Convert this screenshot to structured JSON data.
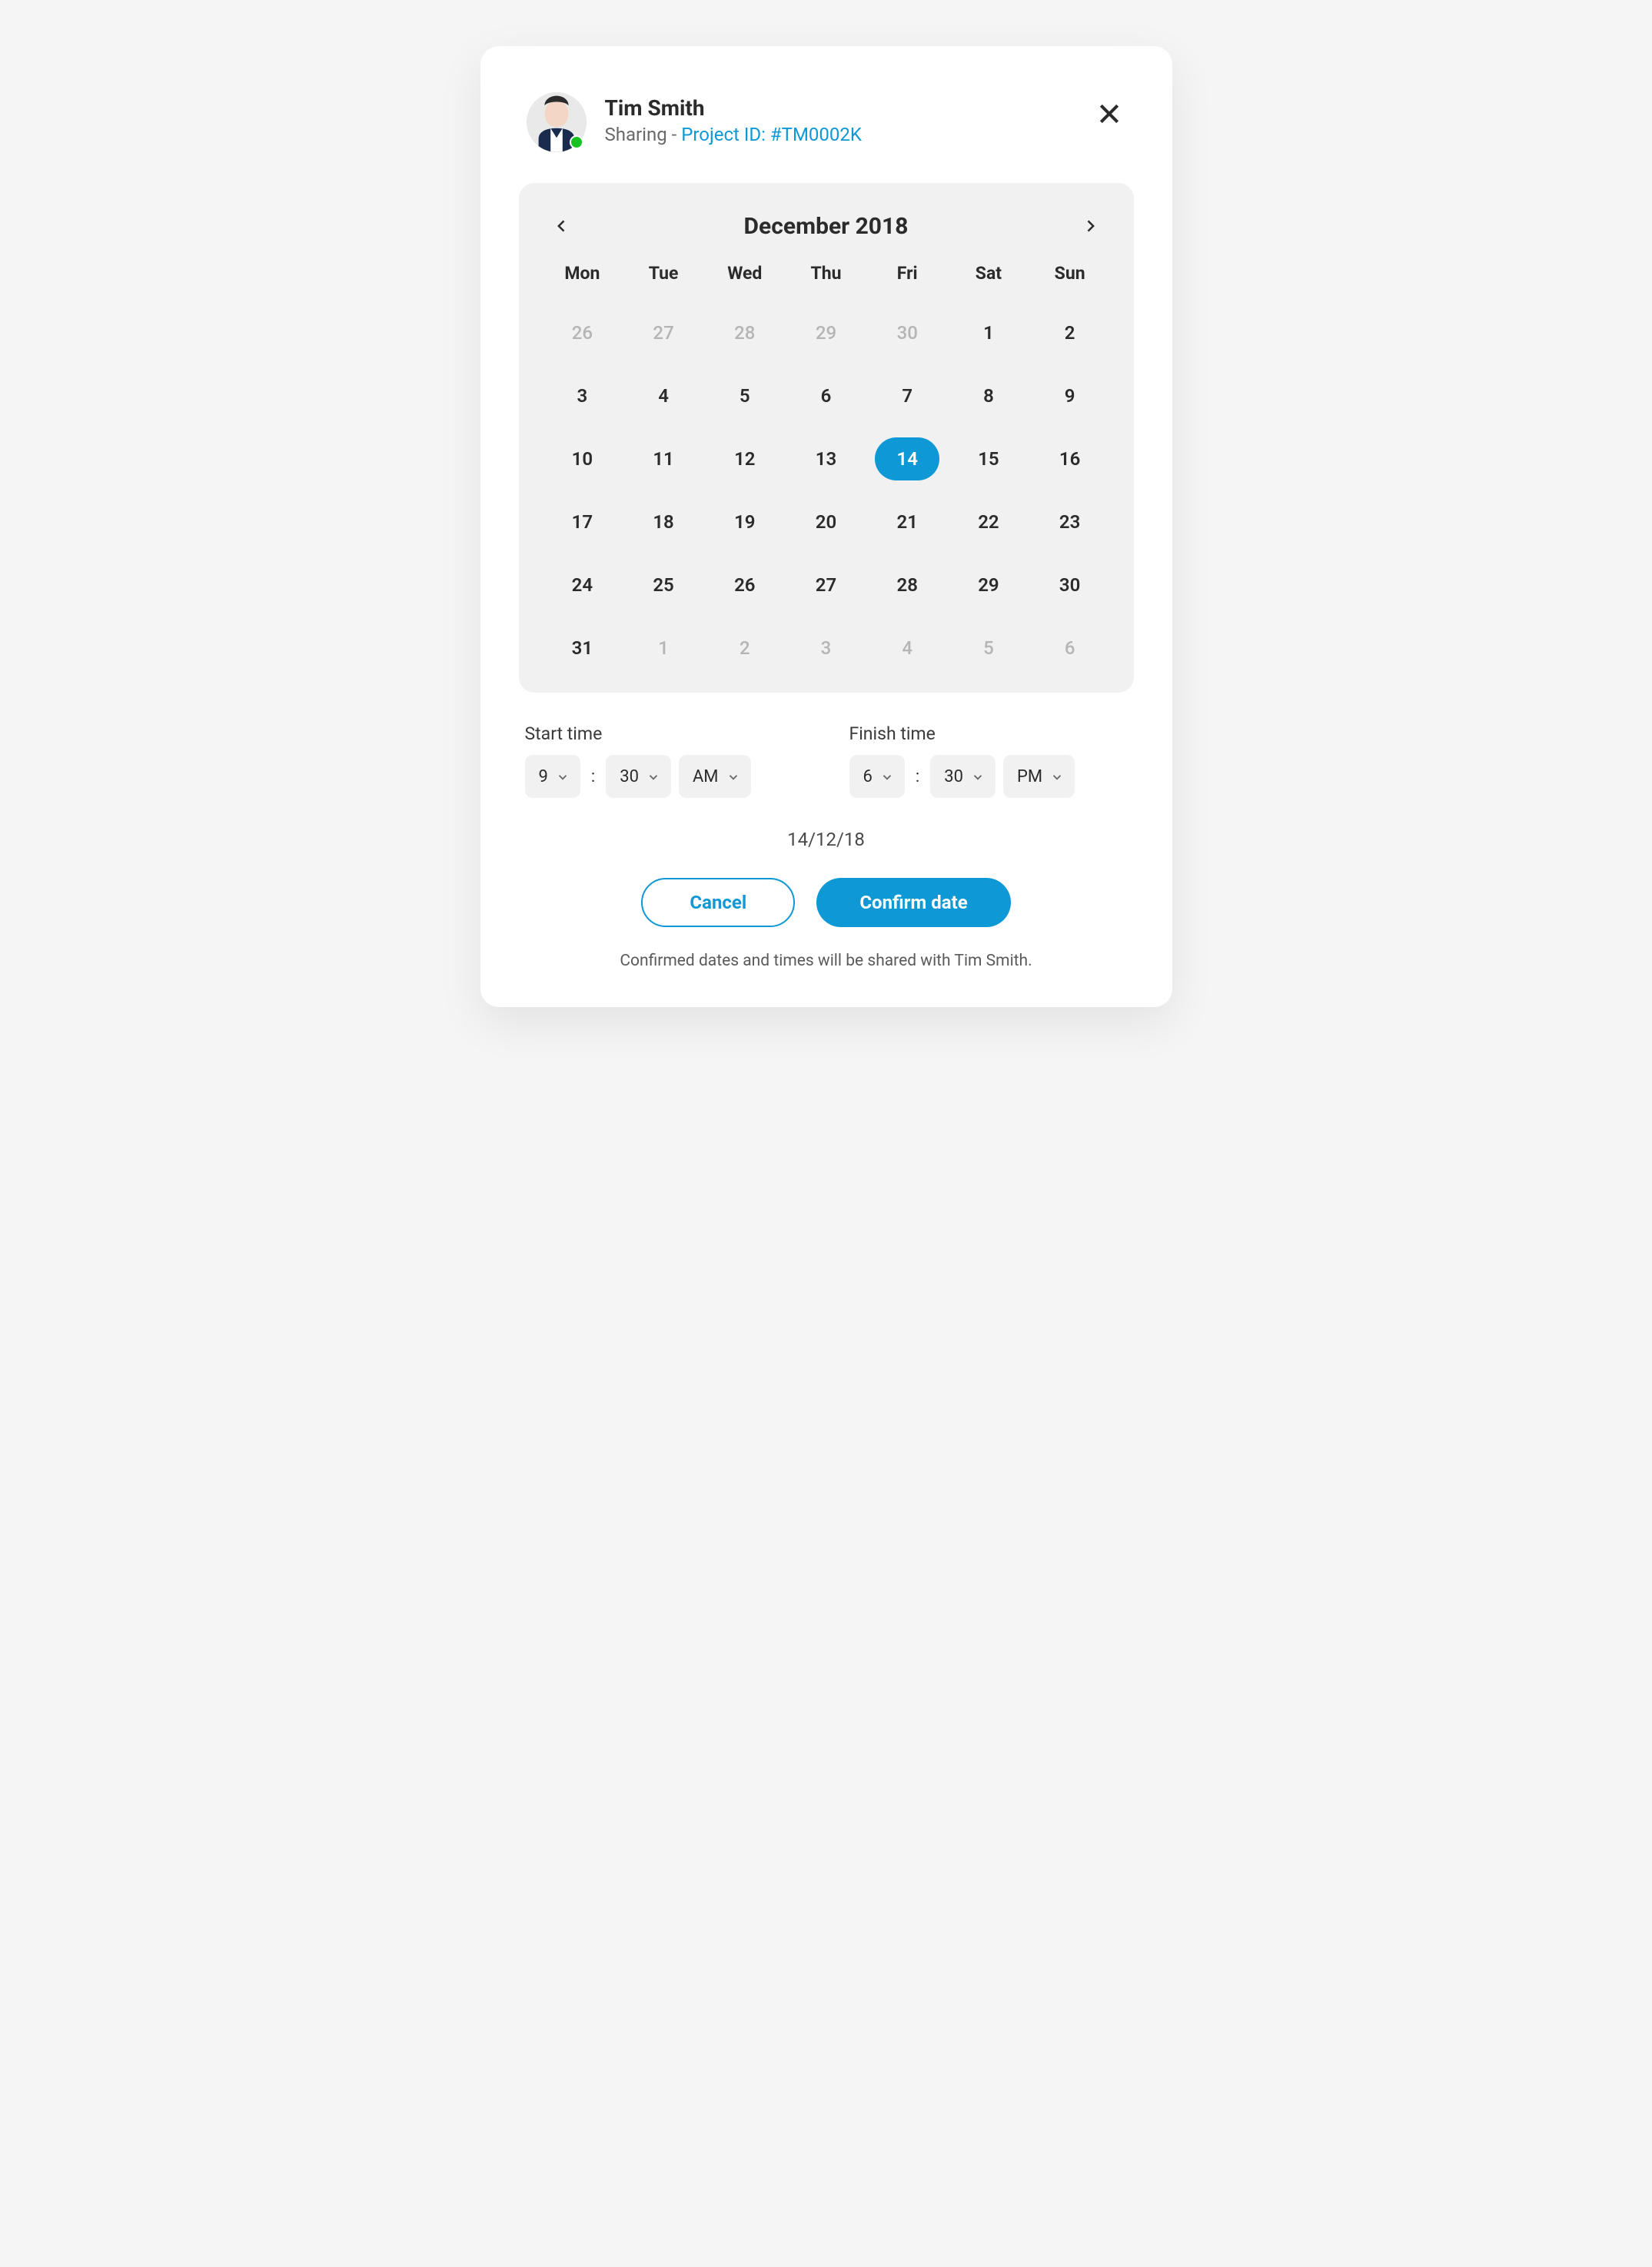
{
  "header": {
    "user_name": "Tim Smith",
    "sharing_prefix": "Sharing - ",
    "project_link_text": "Project ID: #TM0002K"
  },
  "calendar": {
    "month_label": "December 2018",
    "dow": [
      "Mon",
      "Tue",
      "Wed",
      "Thu",
      "Fri",
      "Sat",
      "Sun"
    ],
    "days": [
      {
        "n": "26",
        "other": true
      },
      {
        "n": "27",
        "other": true
      },
      {
        "n": "28",
        "other": true
      },
      {
        "n": "29",
        "other": true
      },
      {
        "n": "30",
        "other": true
      },
      {
        "n": "1"
      },
      {
        "n": "2"
      },
      {
        "n": "3"
      },
      {
        "n": "4"
      },
      {
        "n": "5"
      },
      {
        "n": "6"
      },
      {
        "n": "7"
      },
      {
        "n": "8"
      },
      {
        "n": "9"
      },
      {
        "n": "10"
      },
      {
        "n": "11"
      },
      {
        "n": "12"
      },
      {
        "n": "13"
      },
      {
        "n": "14",
        "selected": true
      },
      {
        "n": "15"
      },
      {
        "n": "16"
      },
      {
        "n": "17"
      },
      {
        "n": "18"
      },
      {
        "n": "19"
      },
      {
        "n": "20"
      },
      {
        "n": "21"
      },
      {
        "n": "22"
      },
      {
        "n": "23"
      },
      {
        "n": "24"
      },
      {
        "n": "25"
      },
      {
        "n": "26"
      },
      {
        "n": "27"
      },
      {
        "n": "28"
      },
      {
        "n": "29"
      },
      {
        "n": "30"
      },
      {
        "n": "31"
      },
      {
        "n": "1",
        "other": true
      },
      {
        "n": "2",
        "other": true
      },
      {
        "n": "3",
        "other": true
      },
      {
        "n": "4",
        "other": true
      },
      {
        "n": "5",
        "other": true
      },
      {
        "n": "6",
        "other": true
      }
    ]
  },
  "time": {
    "start_label": "Start time",
    "finish_label": "Finish time",
    "start_hour": "9",
    "start_minute": "30",
    "start_period": "AM",
    "finish_hour": "6",
    "finish_minute": "30",
    "finish_period": "PM",
    "colon": ":"
  },
  "selected_date": "14/12/18",
  "actions": {
    "cancel": "Cancel",
    "confirm": "Confirm date"
  },
  "footnote": "Confirmed dates and times will be shared with Tim Smith.",
  "colors": {
    "accent": "#0e98d6",
    "status_online": "#18c223"
  }
}
